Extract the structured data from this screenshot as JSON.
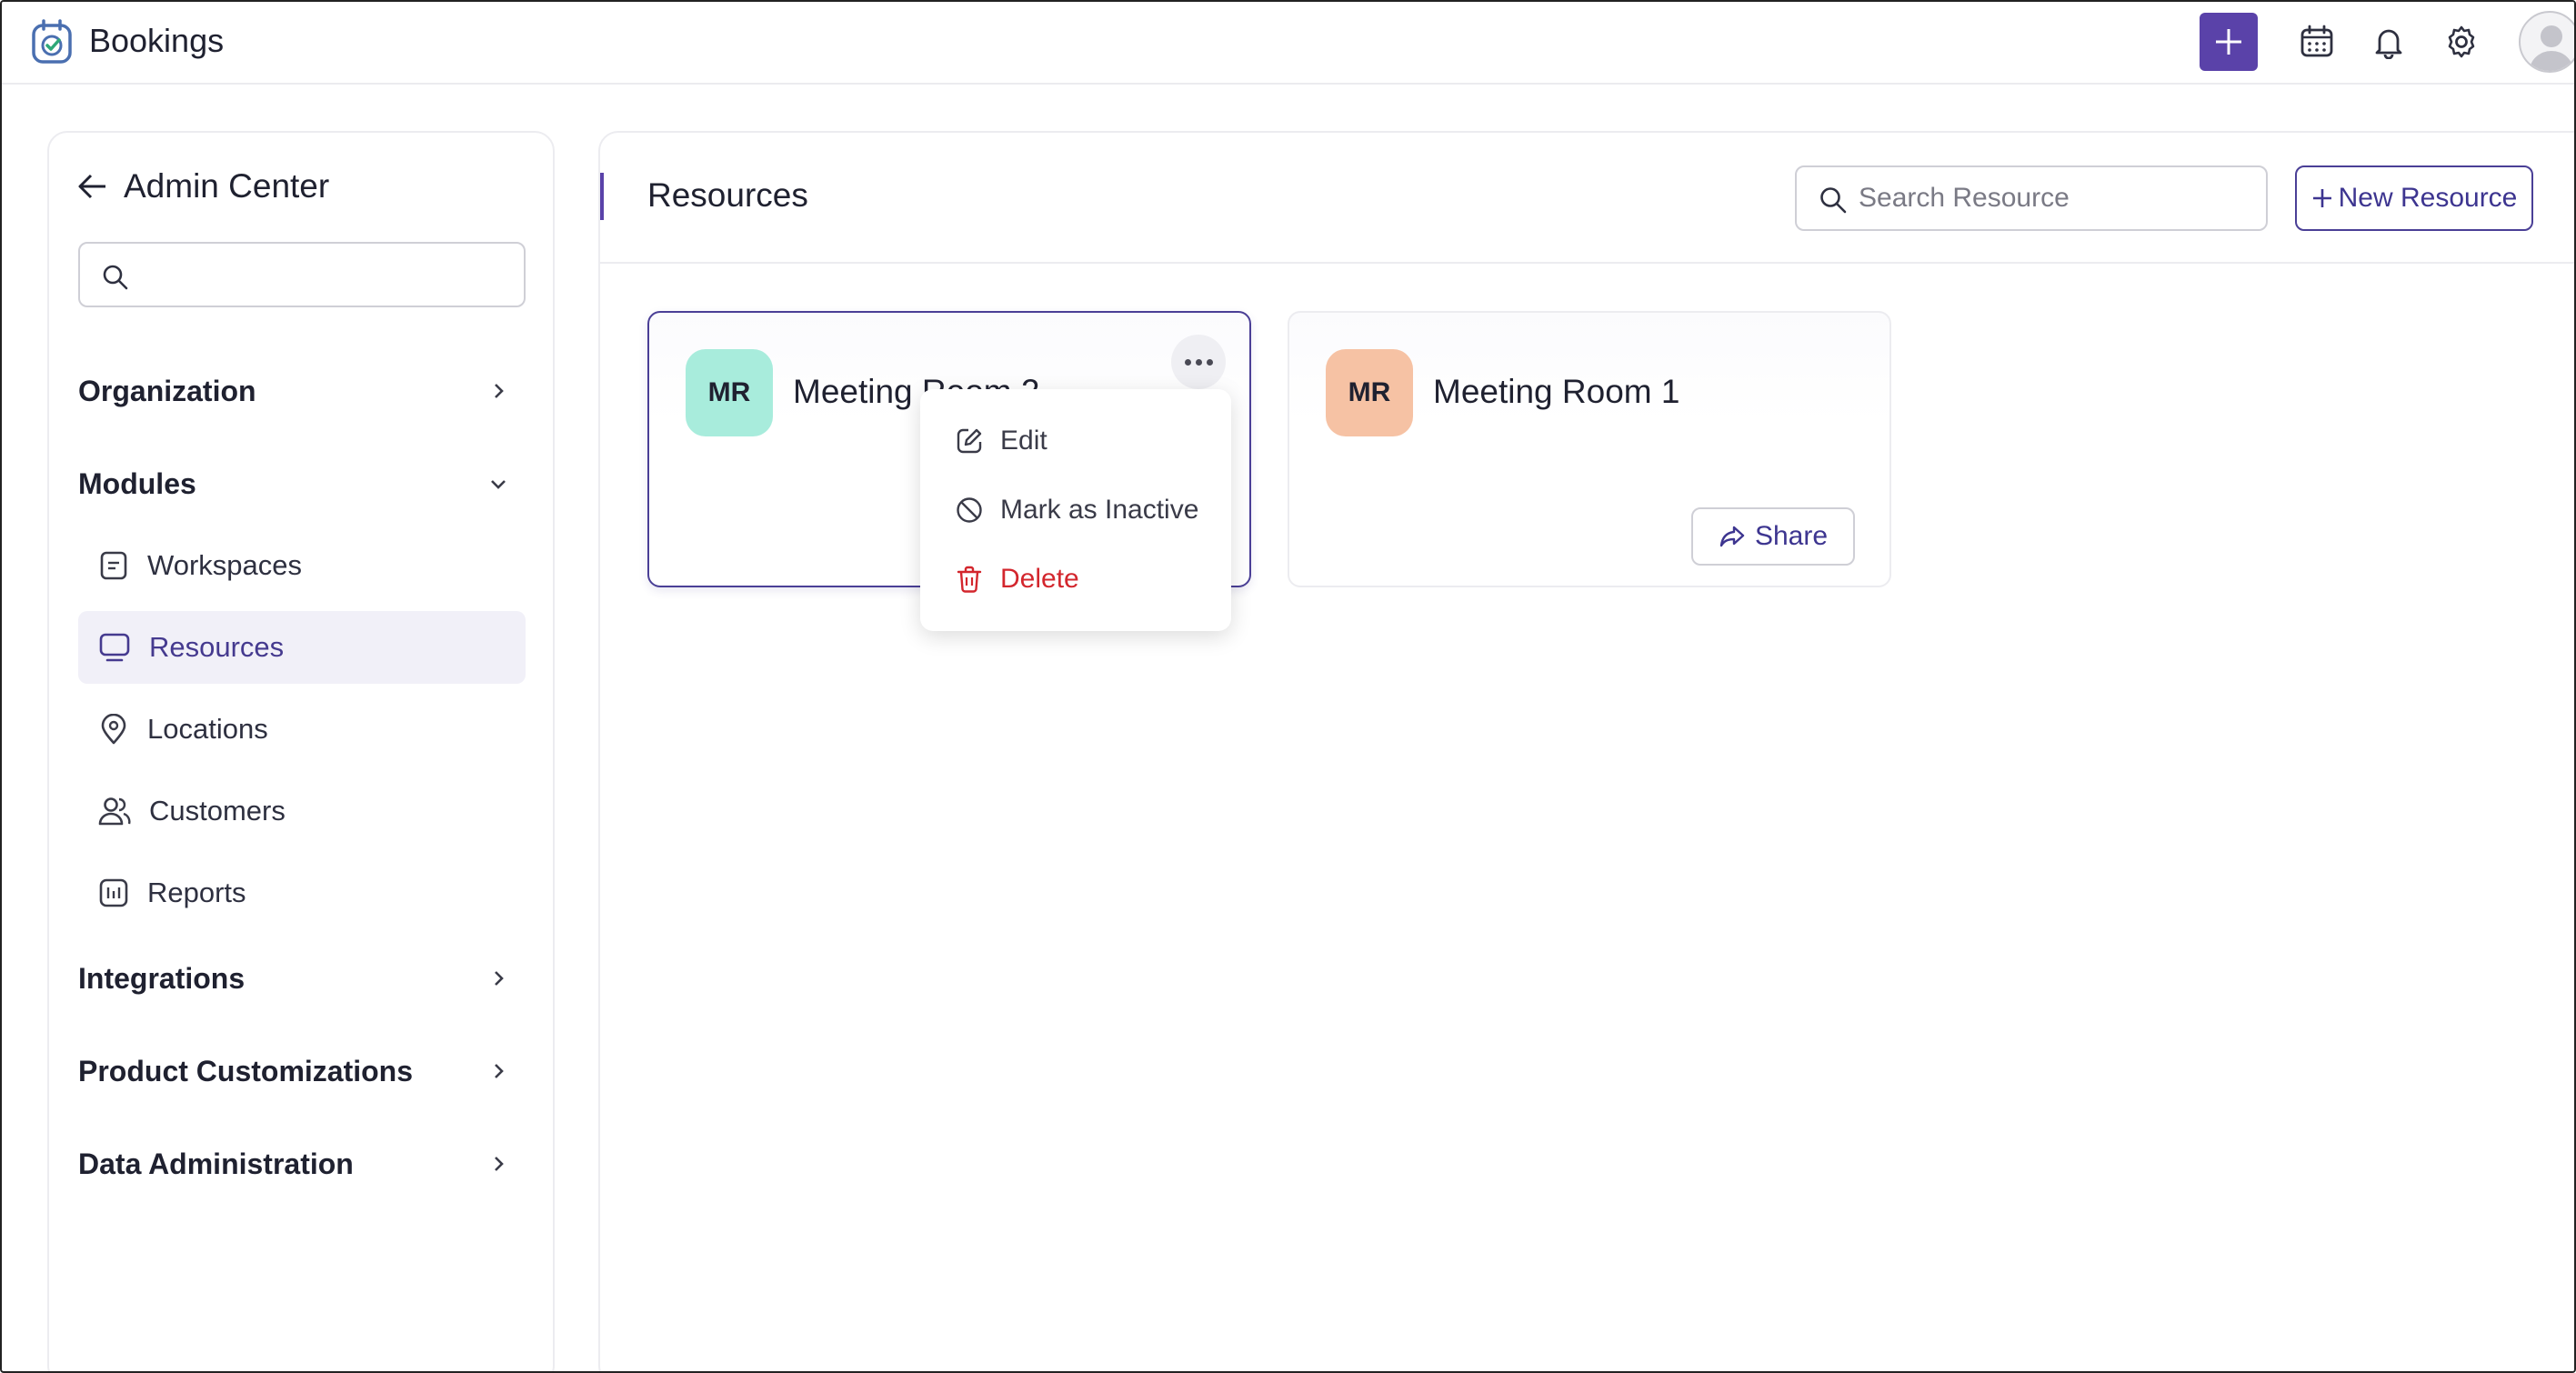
{
  "app": {
    "title": "Bookings"
  },
  "topbar": {
    "icons": [
      "plus-icon",
      "calendar-icon",
      "bell-icon",
      "gear-icon",
      "avatar"
    ]
  },
  "sidebar": {
    "back_title": "Admin Center",
    "search_value": "",
    "sections": [
      {
        "label": "Organization",
        "expanded": false
      },
      {
        "label": "Modules",
        "expanded": true
      },
      {
        "label": "Integrations",
        "expanded": false
      },
      {
        "label": "Product Customizations",
        "expanded": false
      },
      {
        "label": "Data Administration",
        "expanded": false
      }
    ],
    "module_items": [
      {
        "label": "Workspaces",
        "icon": "document-icon"
      },
      {
        "label": "Resources",
        "icon": "monitor-icon",
        "active": true
      },
      {
        "label": "Locations",
        "icon": "location-pin-icon"
      },
      {
        "label": "Customers",
        "icon": "users-icon"
      },
      {
        "label": "Reports",
        "icon": "reports-icon"
      }
    ]
  },
  "main": {
    "title": "Resources",
    "search_placeholder": "Search Resource",
    "new_button": "New Resource",
    "cards": [
      {
        "initials": "MR",
        "name": "Meeting Room 2",
        "badge_color": "#a8ecdc",
        "selected": true
      },
      {
        "initials": "MR",
        "name": "Meeting Room 1",
        "badge_color": "#f6c2a4",
        "share_label": "Share"
      }
    ]
  },
  "context_menu": {
    "items": [
      {
        "label": "Edit",
        "icon": "edit-icon"
      },
      {
        "label": "Mark as Inactive",
        "icon": "block-icon"
      },
      {
        "label": "Delete",
        "icon": "trash-icon",
        "danger": true
      }
    ]
  },
  "colors": {
    "accent": "#5a42a9",
    "danger": "#d3262d"
  }
}
